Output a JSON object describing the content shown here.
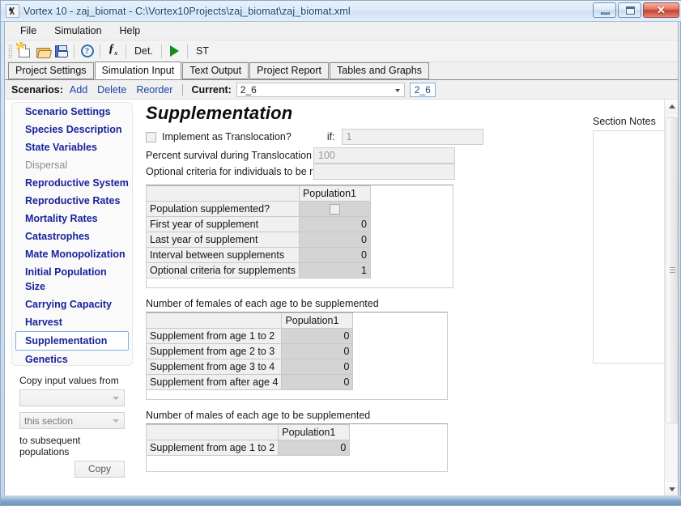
{
  "window": {
    "title": "Vortex 10 - zaj_biomat - C:\\Vortex10Projects\\zaj_biomat\\zaj_biomat.xml",
    "app_icon": "vortex-icon",
    "minimize_label": "—",
    "maximize_label": "□",
    "close_label": "✕"
  },
  "menu": {
    "items": [
      {
        "label": "File"
      },
      {
        "label": "Simulation"
      },
      {
        "label": "Help"
      }
    ]
  },
  "toolbar": {
    "buttons": [
      {
        "icon": "new-file-icon",
        "label": ""
      },
      {
        "icon": "open-folder-icon",
        "label": ""
      },
      {
        "icon": "save-disk-icon",
        "label": ""
      },
      {
        "icon": "help-question-icon",
        "label": ""
      },
      {
        "icon": "function-fx-icon",
        "label": ""
      }
    ],
    "det_label": "Det.",
    "run_icon": "run-play-icon",
    "st_label": "ST"
  },
  "tabs": [
    {
      "label": "Project Settings",
      "active": false
    },
    {
      "label": "Simulation Input",
      "active": true
    },
    {
      "label": "Text Output",
      "active": false
    },
    {
      "label": "Project Report",
      "active": false
    },
    {
      "label": "Tables and Graphs",
      "active": false
    }
  ],
  "scenario_bar": {
    "scenarios_label": "Scenarios:",
    "add_label": "Add",
    "delete_label": "Delete",
    "reorder_label": "Reorder",
    "current_label": "Current:",
    "current_value": "2_6",
    "chip_value": "2_6"
  },
  "sidebar": {
    "items": [
      {
        "label": "Scenario Settings",
        "state": "normal"
      },
      {
        "label": "Species Description",
        "state": "normal"
      },
      {
        "label": "State Variables",
        "state": "normal"
      },
      {
        "label": "Dispersal",
        "state": "disabled"
      },
      {
        "label": "Reproductive System",
        "state": "normal"
      },
      {
        "label": "Reproductive Rates",
        "state": "normal"
      },
      {
        "label": "Mortality Rates",
        "state": "normal"
      },
      {
        "label": "Catastrophes",
        "state": "normal"
      },
      {
        "label": "Mate Monopolization",
        "state": "normal"
      },
      {
        "label": "Initial Population Size",
        "state": "normal"
      },
      {
        "label": "Carrying Capacity",
        "state": "normal"
      },
      {
        "label": "Harvest",
        "state": "normal"
      },
      {
        "label": "Supplementation",
        "state": "selected"
      },
      {
        "label": "Genetics",
        "state": "normal"
      }
    ]
  },
  "copy_panel": {
    "title": "Copy input values from",
    "source_value": "",
    "section_value": "this section",
    "subtitle": "to subsequent populations",
    "copy_button": "Copy"
  },
  "main": {
    "page_title": "Supplementation",
    "translocation_checkbox_label": "Implement as Translocation?",
    "translocation_checked": false,
    "if_label": "if:",
    "if_value": "1",
    "percent_survival_label": "Percent survival during Translocation",
    "percent_survival_value": "100",
    "optional_criteria_label": "Optional criteria for individuals to be released",
    "optional_criteria_value": "",
    "tables": [
      {
        "caption": "",
        "columns": [
          "",
          "Population1"
        ],
        "rows": [
          {
            "label": "Population supplemented?",
            "value": "",
            "type": "checkbox",
            "checked": false
          },
          {
            "label": "First year of supplement",
            "value": "0",
            "type": "number"
          },
          {
            "label": "Last year of supplement",
            "value": "0",
            "type": "number"
          },
          {
            "label": "Interval between supplements",
            "value": "0",
            "type": "number"
          },
          {
            "label": "Optional criteria for supplements",
            "value": "1",
            "type": "number"
          }
        ]
      },
      {
        "caption": "Number of females of each age to be supplemented",
        "columns": [
          "",
          "Population1"
        ],
        "rows": [
          {
            "label": "Supplement from age 1 to 2",
            "value": "0",
            "type": "number"
          },
          {
            "label": "Supplement from age 2 to 3",
            "value": "0",
            "type": "number"
          },
          {
            "label": "Supplement from age 3 to 4",
            "value": "0",
            "type": "number"
          },
          {
            "label": "Supplement from after age 4",
            "value": "0",
            "type": "number"
          }
        ]
      },
      {
        "caption": "Number of males of each age to be supplemented",
        "columns": [
          "",
          "Population1"
        ],
        "rows": [
          {
            "label": "Supplement from age 1 to 2",
            "value": "0",
            "type": "number"
          }
        ]
      }
    ]
  },
  "notes": {
    "label": "Section Notes",
    "value": ""
  },
  "colors": {
    "link": "#1645a8",
    "nav_item": "#19239b",
    "nav_disabled": "#8c8c8c",
    "selection_border": "#7eb0dd",
    "cell_value_bg": "#d4d4d4",
    "header_bg": "#f0f0f0",
    "title_text": "#12406b"
  }
}
